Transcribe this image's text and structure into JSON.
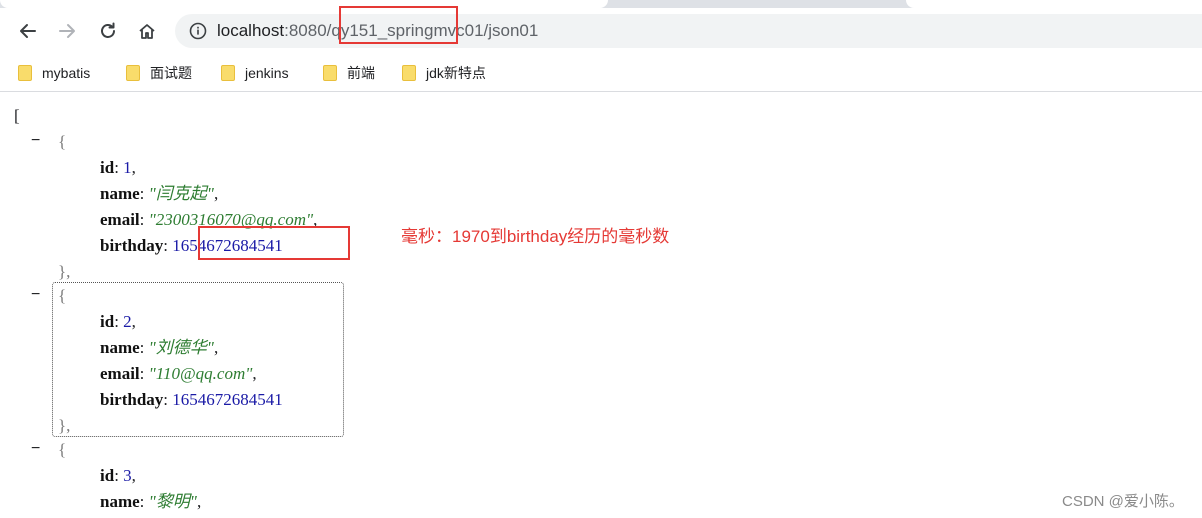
{
  "toolbar": {
    "url_host": "localhost",
    "url_path_rest": ":8080/qy151_springmvc01/json01"
  },
  "bookmarks": [
    {
      "label": "mybatis"
    },
    {
      "label": "面试题"
    },
    {
      "label": "jenkins"
    },
    {
      "label": "前端"
    },
    {
      "label": "jdk新特点"
    }
  ],
  "json_view": {
    "open_bracket": "[",
    "collapse_symbol": "−",
    "open_brace": "{",
    "close_brace": "},",
    "records": [
      {
        "id": "1",
        "name": "\"闫克起\"",
        "email": "\"2300316070@qq.com\"",
        "birthday": "1654672684541"
      },
      {
        "id": "2",
        "name": "\"刘德华\"",
        "email": "\"110@qq.com\"",
        "birthday": "1654672684541"
      },
      {
        "id": "3",
        "name": "\"黎明\""
      }
    ],
    "keys": {
      "id": "id",
      "name": "name",
      "email": "email",
      "birthday": "birthday"
    }
  },
  "annotation": "毫秒：1970到birthday经历的毫秒数",
  "watermark": "CSDN @爱小陈。",
  "colors": {
    "highlight_red": "#e53935",
    "number_blue": "#1a1aa6",
    "string_green": "#2e7d32"
  }
}
